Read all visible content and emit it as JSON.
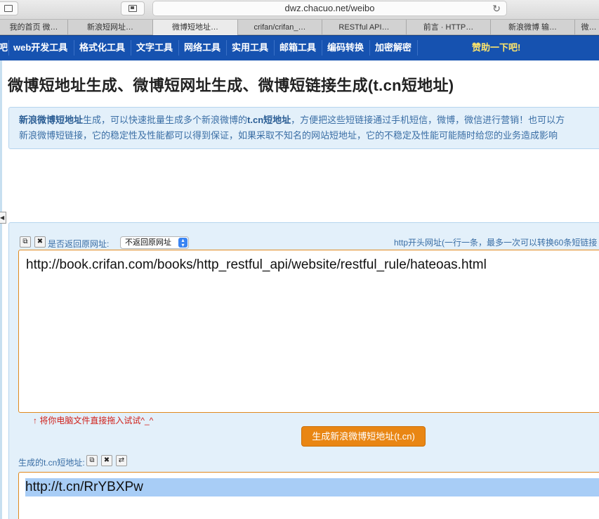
{
  "browser": {
    "url": "dwz.chacuo.net/weibo",
    "tabs": [
      "我的首页 微…",
      "新浪短网址…",
      "微博短地址…",
      "crifan/crifan_…",
      "RESTful API…",
      "前言 · HTTP…",
      "新浪微博 输…",
      "微…"
    ],
    "active_tab": 2
  },
  "nav": {
    "items": [
      "吧",
      "web开发工具",
      "格式化工具",
      "文字工具",
      "网络工具",
      "实用工具",
      "邮箱工具",
      "编码转换",
      "加密解密"
    ],
    "sponsor": "赞助一下吧!"
  },
  "page": {
    "title": "微博短地址生成、微博短网址生成、微博短链接生成(t.cn短地址)",
    "info": {
      "line1_b1": "新浪微博短地址",
      "line1_t1": "生成，可以快速批量生成多个新浪微博的",
      "line1_b2": "t.cn短地址",
      "line1_t2": "，方便把这些短链接通过手机短信，微博，微信进行营销！也可以方",
      "line2": "新浪微博短链接，它的稳定性及性能都可以得到保证，如果采取不知名的网站短地址，它的不稳定及性能可能随时给您的业务造成影响"
    },
    "input": {
      "return_label": "是否返回原网址:",
      "select_value": "不返回原网址",
      "hint_right": "http开头网址(一行一条，最多一次可以转换60条短链接",
      "value": "http://book.crifan.com/books/http_restful_api/website/restful_rule/hateoas.html",
      "drag_hint": "↑ 将你电脑文件直接拖入试试^_^"
    },
    "generate_button": "生成新浪微博短地址(t.cn)",
    "output": {
      "label": "生成的t.cn短地址:",
      "value": "http://t.cn/RrYBXPw"
    }
  }
}
